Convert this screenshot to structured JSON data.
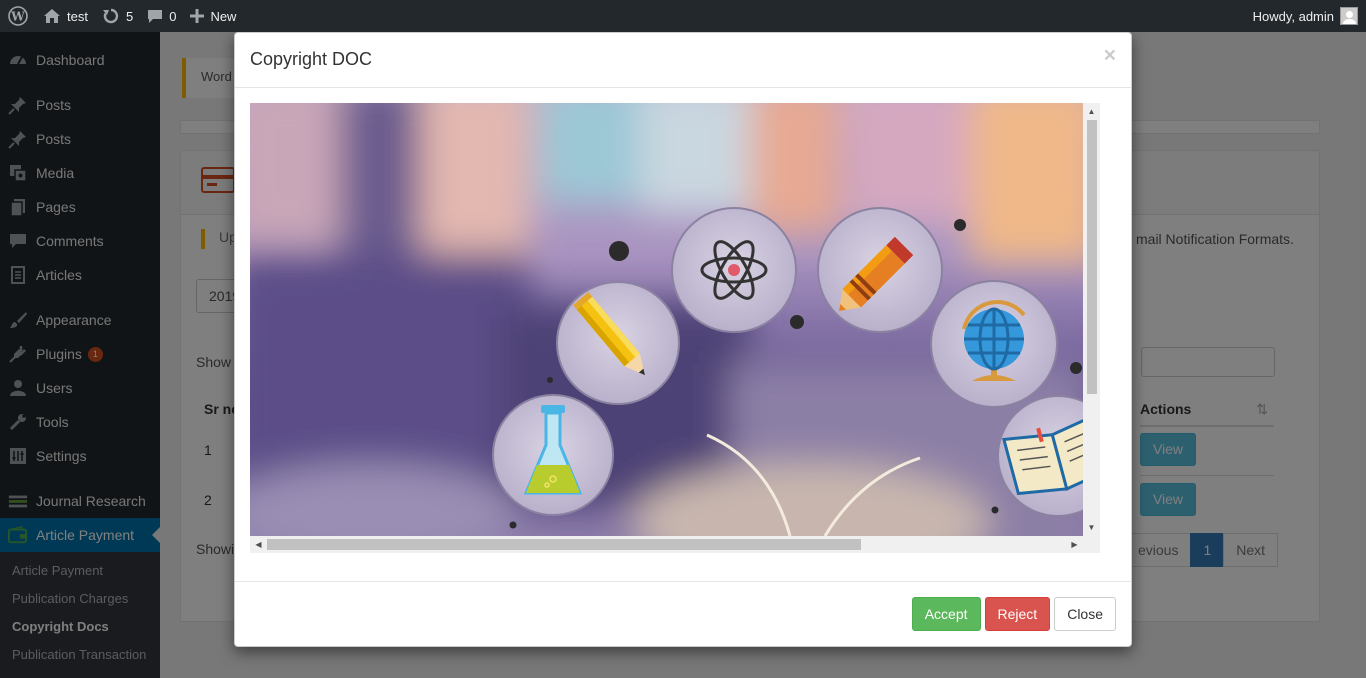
{
  "adminbar": {
    "site_name": "test",
    "updates_count": "5",
    "comments_count": "0",
    "new_label": "New",
    "howdy": "Howdy, admin"
  },
  "sidebar": {
    "items": [
      {
        "label": "Dashboard",
        "icon": "dashboard-icon"
      },
      {
        "label": "Posts",
        "icon": "pin-icon"
      },
      {
        "label": "Posts",
        "icon": "pin-icon"
      },
      {
        "label": "Media",
        "icon": "media-icon"
      },
      {
        "label": "Pages",
        "icon": "pages-icon"
      },
      {
        "label": "Comments",
        "icon": "comment-icon"
      },
      {
        "label": "Articles",
        "icon": "document-icon"
      },
      {
        "label": "Appearance",
        "icon": "brush-icon"
      },
      {
        "label": "Plugins",
        "icon": "plugin-icon",
        "badge": "1"
      },
      {
        "label": "Users",
        "icon": "user-icon"
      },
      {
        "label": "Tools",
        "icon": "wrench-icon"
      },
      {
        "label": "Settings",
        "icon": "settings-icon"
      },
      {
        "label": "Journal Research",
        "icon": "journal-icon"
      },
      {
        "label": "Article Payment",
        "icon": "wallet-icon"
      }
    ],
    "submenu": [
      "Article Payment",
      "Publication Charges",
      "Copyright Docs",
      "Publication Transaction"
    ]
  },
  "background": {
    "notice_text": "Word",
    "update_text": "Up",
    "email_text": "mail Notification Formats.",
    "year_value": "2019",
    "show_text": "Show",
    "col_sr": "Sr no",
    "col_actions": "Actions",
    "rows": [
      {
        "sr": "1",
        "action": "View"
      },
      {
        "sr": "2",
        "action": "View"
      }
    ],
    "showing_text": "Showi",
    "pager": {
      "previous": "evious",
      "current": "1",
      "next": "Next"
    }
  },
  "modal": {
    "title": "Copyright DOC",
    "close_x": "×",
    "accept_label": "Accept",
    "reject_label": "Reject",
    "close_label": "Close"
  },
  "colors": {
    "accent": "#0073aa",
    "success": "#5cb85c",
    "danger": "#d9534f",
    "info": "#5bc0de",
    "notice": "#ffb900"
  }
}
